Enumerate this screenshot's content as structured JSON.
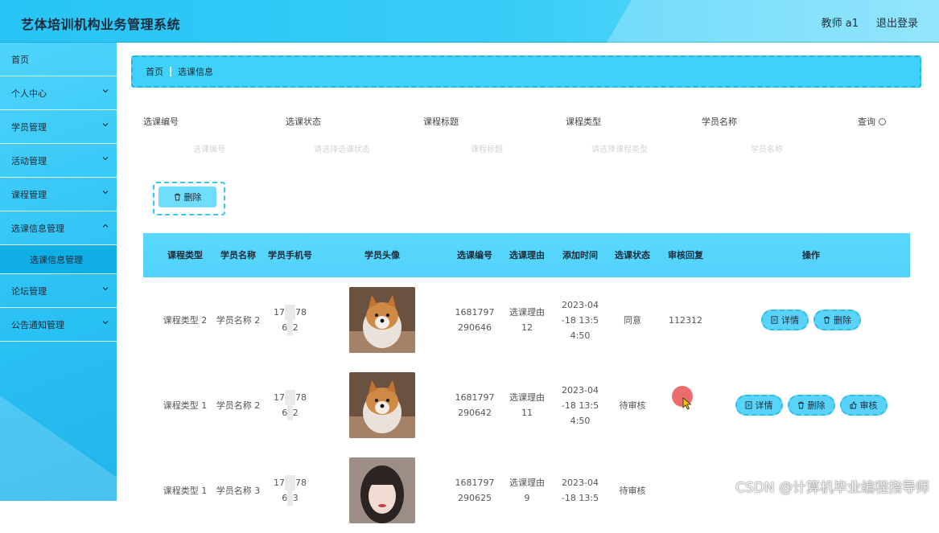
{
  "header": {
    "title": "艺体培训机构业务管理系统",
    "user": "教师 a1",
    "logout": "退出登录"
  },
  "sidebar": {
    "items": [
      {
        "label": "首页",
        "arrow": false
      },
      {
        "label": "个人中心",
        "arrow": true
      },
      {
        "label": "学员管理",
        "arrow": true
      },
      {
        "label": "活动管理",
        "arrow": true
      },
      {
        "label": "课程管理",
        "arrow": true
      },
      {
        "label": "选课信息管理",
        "arrow": true
      },
      {
        "label": "论坛管理",
        "arrow": true
      },
      {
        "label": "公告通知管理",
        "arrow": true
      }
    ],
    "sub_item": "选课信息管理"
  },
  "breadcrumb": {
    "home": "首页",
    "current": "选课信息"
  },
  "filters": {
    "labels": [
      "选课编号",
      "选课状态",
      "课程标题",
      "课程类型",
      "学员名称"
    ],
    "placeholders": [
      "选课编号",
      "请选择选课状态",
      "课程标题",
      "请选择课程类型",
      "学员名称"
    ],
    "search": "查询"
  },
  "toolbar": {
    "delete_label": "删除"
  },
  "table": {
    "headers": [
      "课程类型",
      "学员名称",
      "学员手机号",
      "学员头像",
      "选课编号",
      "选课理由",
      "添加时间",
      "选课状态",
      "审核回复",
      "操作"
    ],
    "rows": [
      {
        "type": "课程类型 2",
        "name": "学员名称 2",
        "phone_a": "17",
        "phone_b": "78",
        "phone_c": "6",
        "phone_d": "2",
        "id_a": "1681797",
        "id_b": "290646",
        "reason_a": "选课理由",
        "reason_b": "12",
        "time_a": "2023-04",
        "time_b": "-18 13:5",
        "time_c": "4:50",
        "status": "同意",
        "reply": "112312",
        "actions": [
          "详情",
          "删除"
        ]
      },
      {
        "type": "课程类型 1",
        "name": "学员名称 2",
        "phone_a": "17",
        "phone_b": "78",
        "phone_c": "6",
        "phone_d": "2",
        "id_a": "1681797",
        "id_b": "290642",
        "reason_a": "选课理由",
        "reason_b": "11",
        "time_a": "2023-04",
        "time_b": "-18 13:5",
        "time_c": "4:50",
        "status": "待审核",
        "reply": "",
        "actions": [
          "详情",
          "删除",
          "审核"
        ]
      },
      {
        "type": "课程类型 1",
        "name": "学员名称 3",
        "phone_a": "17",
        "phone_b": "78",
        "phone_c": "6",
        "phone_d": "3",
        "id_a": "1681797",
        "id_b": "290625",
        "reason_a": "选课理由",
        "reason_b": "9",
        "time_a": "2023-04",
        "time_b": "-18 13:5",
        "time_c": "",
        "status": "待审核",
        "reply": "",
        "actions": []
      }
    ]
  },
  "watermark": "CSDN @计算机毕业编程指导师",
  "colors": {
    "accent": "#2ec4f5",
    "header_bg": "#38cdf7",
    "button": "#5ad3fb"
  }
}
